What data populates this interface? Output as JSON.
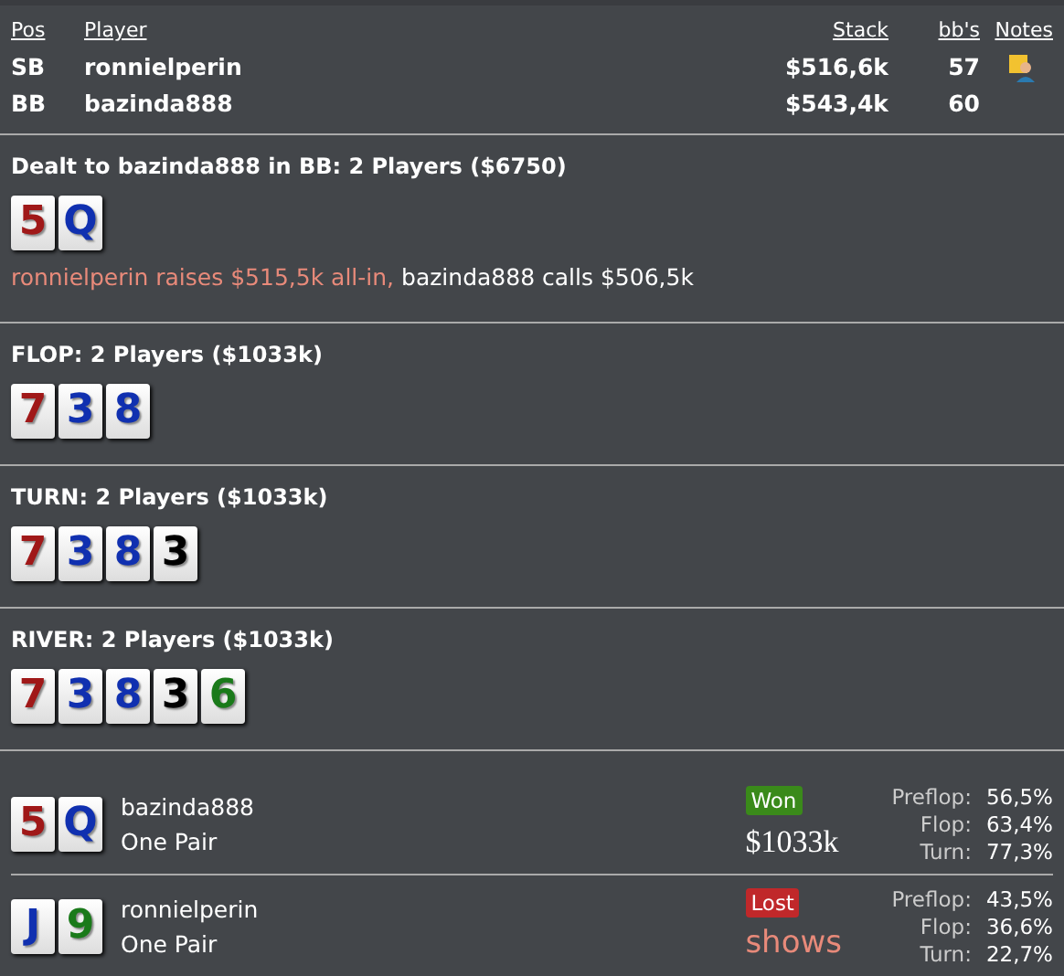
{
  "players_table": {
    "columns": [
      "Pos",
      "Player",
      "Stack",
      "bb's",
      "Notes"
    ],
    "rows": [
      {
        "pos": "SB",
        "player": "ronnielperin",
        "stack": "$516,6k",
        "bbs": "57",
        "has_note": true
      },
      {
        "pos": "BB",
        "player": "bazinda888",
        "stack": "$543,4k",
        "bbs": "60",
        "has_note": false
      }
    ]
  },
  "streets": [
    {
      "title": "Dealt to bazinda888 in BB: 2 Players ($6750)",
      "cards": [
        {
          "rank": "5",
          "color": "#a01818"
        },
        {
          "rank": "Q",
          "color": "#1030b0"
        }
      ],
      "actions": [
        {
          "text": "ronnielperin raises $515,5k all-in,",
          "kind": "aggressive"
        },
        {
          "text": "bazinda888 calls $506,5k",
          "kind": "passive"
        }
      ]
    },
    {
      "title": "FLOP: 2 Players ($1033k)",
      "cards": [
        {
          "rank": "7",
          "color": "#a01818"
        },
        {
          "rank": "3",
          "color": "#1030b0"
        },
        {
          "rank": "8",
          "color": "#1030b0"
        }
      ]
    },
    {
      "title": "TURN: 2 Players ($1033k)",
      "cards": [
        {
          "rank": "7",
          "color": "#a01818"
        },
        {
          "rank": "3",
          "color": "#1030b0"
        },
        {
          "rank": "8",
          "color": "#1030b0"
        },
        {
          "rank": "3",
          "color": "#000000"
        }
      ]
    },
    {
      "title": "RIVER: 2 Players ($1033k)",
      "cards": [
        {
          "rank": "7",
          "color": "#a01818"
        },
        {
          "rank": "3",
          "color": "#1030b0"
        },
        {
          "rank": "8",
          "color": "#1030b0"
        },
        {
          "rank": "3",
          "color": "#000000"
        },
        {
          "rank": "6",
          "color": "#1a7a1a"
        }
      ]
    }
  ],
  "results": [
    {
      "cards": [
        {
          "rank": "5",
          "color": "#a01818"
        },
        {
          "rank": "Q",
          "color": "#1030b0"
        }
      ],
      "player": "bazinda888",
      "hand": "One Pair",
      "won": true,
      "badge": "Won",
      "amount": "$1033k",
      "equity": [
        {
          "label": "Preflop:",
          "value": "56,5%"
        },
        {
          "label": "Flop:",
          "value": "63,4%"
        },
        {
          "label": "Turn:",
          "value": "77,3%"
        }
      ]
    },
    {
      "cards": [
        {
          "rank": "J",
          "color": "#1030b0"
        },
        {
          "rank": "9",
          "color": "#1a7a1a"
        }
      ],
      "player": "ronnielperin",
      "hand": "One Pair",
      "won": false,
      "badge": "Lost",
      "amount": "shows",
      "equity": [
        {
          "label": "Preflop:",
          "value": "43,5%"
        },
        {
          "label": "Flop:",
          "value": "36,6%"
        },
        {
          "label": "Turn:",
          "value": "22,7%"
        }
      ]
    }
  ]
}
